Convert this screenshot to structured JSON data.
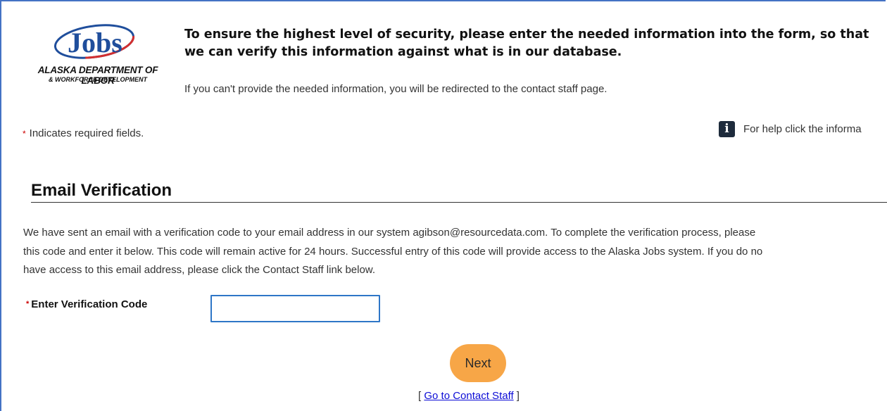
{
  "logo": {
    "wordmark": "Jobs",
    "org_line1": "ALASKA DEPARTMENT OF LABOR",
    "org_line2": "& WORKFORCE DEVELOPMENT",
    "colors": {
      "swoosh": "#1f4e9c",
      "accent": "#d32f2f"
    }
  },
  "header": {
    "headline": "To ensure the highest level of security, please enter the needed information into the form, so that we can verify this information against what is in our database.",
    "subnote": "If you can't provide the needed information, you will be redirected to the contact staff page."
  },
  "required_note": {
    "star": "*",
    "text": "Indicates required fields."
  },
  "help": {
    "icon": "info-icon",
    "icon_glyph": "i",
    "text": "For help click the informa"
  },
  "section": {
    "title": "Email Verification",
    "body_lines": [
      "We have sent an email with a verification code to your email address in our system agibson@resourcedata.com. To complete the verification process, please",
      "this code and enter it below. This code will remain active for 24 hours. Successful entry of this code will provide access to the Alaska Jobs system. If you do no",
      "have access to this email address, please click the Contact Staff link below."
    ]
  },
  "form": {
    "code_label": "Enter Verification Code",
    "required_star": "*",
    "code_value": ""
  },
  "actions": {
    "next_label": "Next",
    "contact_prefix": "[ ",
    "contact_link": "Go to Contact Staff",
    "contact_suffix": " ]"
  },
  "colors": {
    "next_button": "#f7a647",
    "input_border": "#2e76c7",
    "link": "#0b0bd6",
    "required": "#cc0000"
  }
}
